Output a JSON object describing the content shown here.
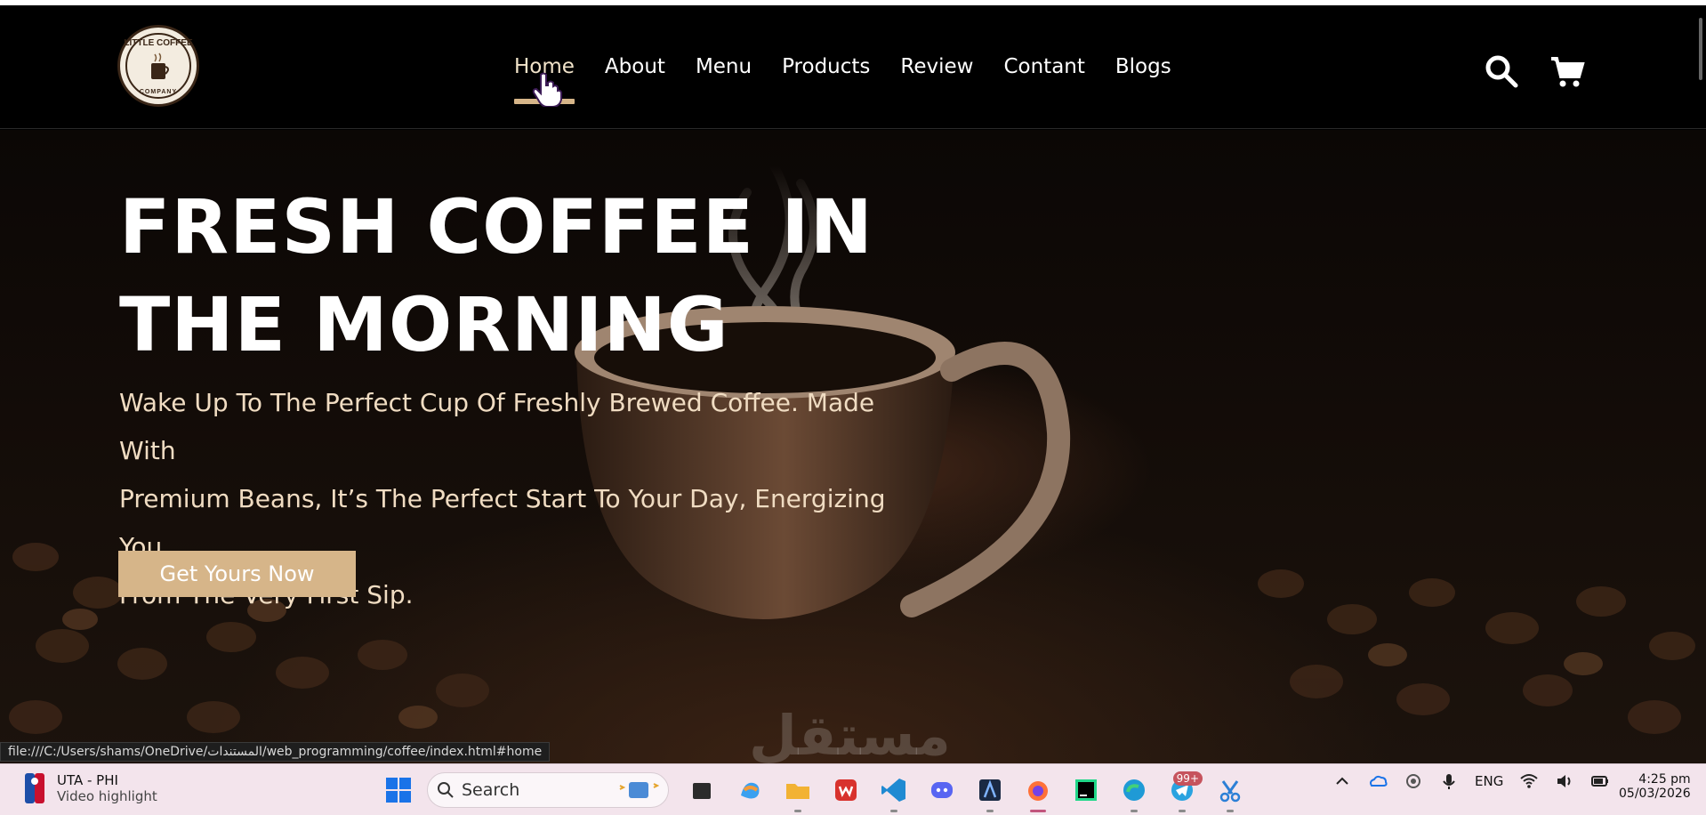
{
  "brand": {
    "logo_text_top": "LITTLE COFFEE",
    "logo_text_bottom": "COMPANY"
  },
  "nav": {
    "items": [
      {
        "label": "Home",
        "active": true
      },
      {
        "label": "About"
      },
      {
        "label": "Menu"
      },
      {
        "label": "Products"
      },
      {
        "label": "Review"
      },
      {
        "label": "Contant"
      },
      {
        "label": "Blogs"
      }
    ]
  },
  "header_icons": [
    "search-icon",
    "cart-icon"
  ],
  "hero": {
    "title_line1": "FRESH COFFEE IN",
    "title_line2": "THE MORNING",
    "text_line1": "Wake Up To The Perfect Cup Of Freshly Brewed Coffee. Made With",
    "text_line2": "Premium Beans, It’s The Perfect Start To Your Day, Energizing You",
    "text_line3": "From The Very First Sip.",
    "cta": "Get Yours Now"
  },
  "watermark": "مستقل",
  "status_url": "file:///C:/Users/shams/OneDrive/المستندات/web_programming/coffee/index.html#home",
  "taskbar": {
    "widget_title": "UTA - PHI",
    "widget_subtitle": "Video highlight",
    "search_label": "Search",
    "apps": [
      "file-icon",
      "copilot-icon",
      "folder-icon",
      "wps-icon",
      "vscode-icon",
      "discord-icon",
      "app-icon",
      "firefox-icon",
      "clion-icon",
      "edge-icon",
      "telegram-icon",
      "snipping-icon"
    ],
    "telegram_badge": "99+",
    "lang": "ENG",
    "time": "4:25 pm",
    "date": "05/03/2026"
  },
  "colors": {
    "accent": "#d6b589",
    "header_bg": "#000000",
    "hero_text": "#f0dcc2",
    "taskbar_bg": "#f3e4ec"
  }
}
